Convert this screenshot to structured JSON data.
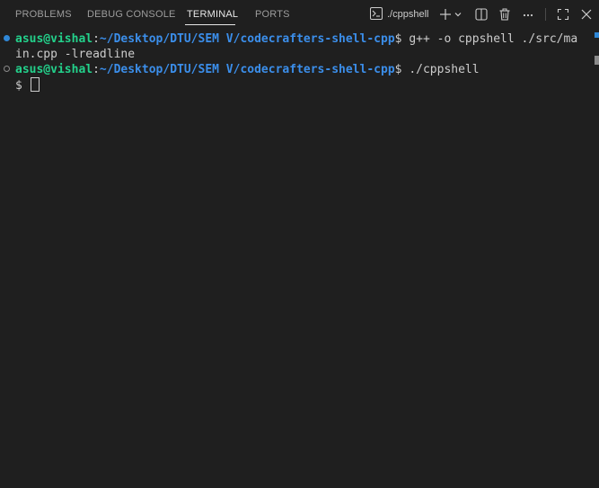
{
  "tabs": [
    {
      "label": "PROBLEMS"
    },
    {
      "label": "DEBUG CONSOLE"
    },
    {
      "label": "TERMINAL"
    },
    {
      "label": "PORTS"
    }
  ],
  "active_tab": "TERMINAL",
  "terminal_selector": {
    "label": "./cppshell",
    "icon": "terminal-icon"
  },
  "toolbar_icons": [
    "plus-icon",
    "chevron-down-icon",
    "split-icon",
    "trash-icon",
    "more-icon",
    "maximize-icon",
    "close-icon"
  ],
  "terminal": {
    "lines": [
      {
        "user": "asus@vishal",
        "colon": ":",
        "path": "~/Desktop/DTU/SEM V/codecrafters-shell-cpp",
        "prompt": "$ ",
        "command": "g++ -o cppshell ./src/ma"
      },
      {
        "continuation": "in.cpp -lreadline"
      },
      {
        "user": "asus@vishal",
        "colon": ":",
        "path": "~/Desktop/DTU/SEM V/codecrafters-shell-cpp",
        "prompt": "$ ",
        "command": "./cppshell"
      },
      {
        "continuation": "$ "
      }
    ]
  },
  "colors": {
    "background": "#1f1f1f",
    "user": "#23d18b",
    "path": "#3b8eea",
    "text": "#cccccc",
    "accent": "#2f87d6"
  }
}
